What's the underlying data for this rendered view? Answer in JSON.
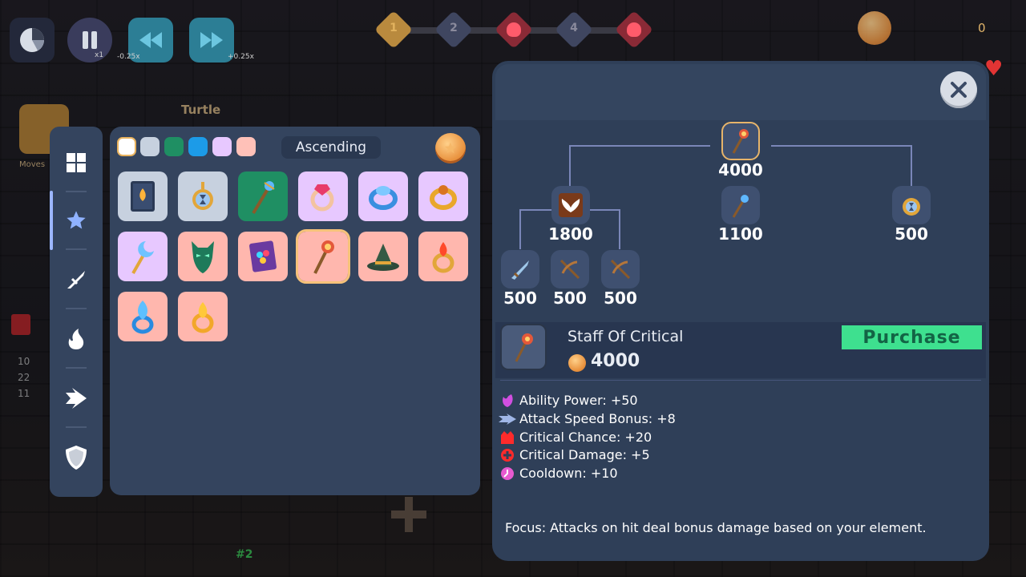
{
  "hud": {
    "speed_label": "x1",
    "rewind_label": "-0.25x",
    "forward_label": "+0.25x",
    "gold_count": "0",
    "waves": [
      "1",
      "2",
      "",
      "4",
      ""
    ]
  },
  "background": {
    "enemy_name": "Turtle",
    "moves_label": "Moves",
    "stats": [
      "10",
      "22",
      "11"
    ],
    "wave_tag": "#2"
  },
  "sidebar": {
    "items": [
      "grid-icon",
      "star-icon",
      "sword-icon",
      "flame-icon",
      "arrow-icon",
      "shield-icon"
    ],
    "active_index": 1
  },
  "inventory": {
    "sort_label": "Ascending",
    "swatch_colors": [
      "#ffffff",
      "#c7d1df",
      "#1f8f63",
      "#1c9be8",
      "#e7c8ff",
      "#ffc1b8"
    ],
    "items": [
      {
        "name": "spellbook",
        "bg": "#c7d1df"
      },
      {
        "name": "hourglass-amulet",
        "bg": "#c7d1df"
      },
      {
        "name": "blue-staff",
        "bg": "#1f8f63"
      },
      {
        "name": "ruby-ring",
        "bg": "#e7c8ff"
      },
      {
        "name": "sapphire-ring",
        "bg": "#e7c8ff"
      },
      {
        "name": "gold-ring",
        "bg": "#e7c8ff"
      },
      {
        "name": "moon-staff",
        "bg": "#e7c8ff"
      },
      {
        "name": "demon-mask",
        "bg": "#ffb7ae"
      },
      {
        "name": "gem-tome",
        "bg": "#ffb7ae"
      },
      {
        "name": "staff-of-critical",
        "bg": "#ffb7ae",
        "selected": true
      },
      {
        "name": "witch-hat",
        "bg": "#ffb7ae"
      },
      {
        "name": "fire-ring",
        "bg": "#ffb7ae"
      },
      {
        "name": "frost-ring",
        "bg": "#ffb7ae"
      },
      {
        "name": "flame-ring",
        "bg": "#ffb7ae"
      }
    ]
  },
  "detail": {
    "tree": {
      "root_price": "4000",
      "mid_prices": [
        "1800",
        "1100",
        "500"
      ],
      "leaf_prices": [
        "500",
        "500",
        "500"
      ]
    },
    "item_name": "Staff Of Critical",
    "price": "4000",
    "purchase_label": "Purchase",
    "stats": [
      {
        "label": "Ability Power: +50",
        "icon": "ability-power-icon",
        "color": "#d14fe0"
      },
      {
        "label": "Attack Speed Bonus: +8",
        "icon": "attack-speed-icon",
        "color": "#9fb6e6"
      },
      {
        "label": "Critical Chance: +20",
        "icon": "crit-chance-icon",
        "color": "#ff2b2b"
      },
      {
        "label": "Critical Damage: +5",
        "icon": "crit-damage-icon",
        "color": "#ff2b2b"
      },
      {
        "label": "Cooldown: +10",
        "icon": "cooldown-icon",
        "color": "#e75ad0"
      }
    ],
    "focus_text": "Focus: Attacks on hit deal bonus damage based on your element."
  }
}
